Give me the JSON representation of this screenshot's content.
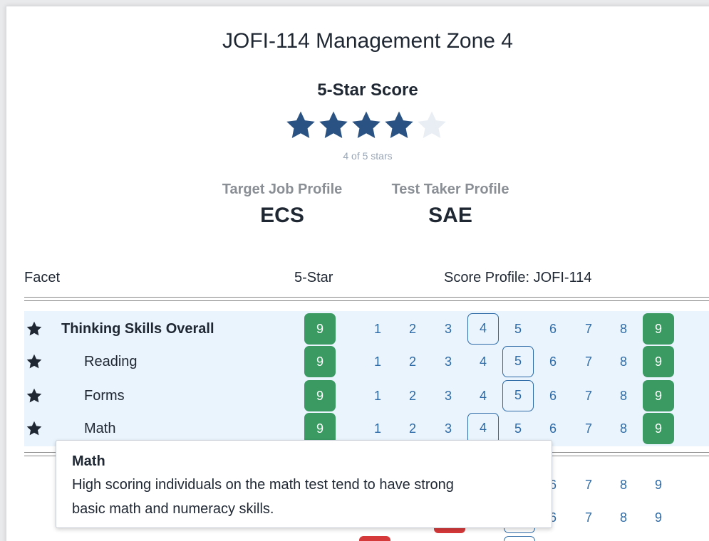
{
  "title": "JOFI-114 Management Zone 4",
  "score": {
    "heading": "5-Star Score",
    "stars_filled": 4,
    "stars_total": 5,
    "caption": "4 of 5 stars",
    "filled_color": "#2a5282",
    "empty_color": "#e9eef4"
  },
  "profiles": {
    "target": {
      "label": "Target Job Profile",
      "value": "ECS"
    },
    "taker": {
      "label": "Test Taker Profile",
      "value": "SAE"
    }
  },
  "table": {
    "headers": {
      "facet": "Facet",
      "five_star": "5-Star",
      "score_profile": "Score Profile: JOFI-114"
    },
    "scale": [
      "1",
      "2",
      "3",
      "4",
      "5",
      "6",
      "7",
      "8",
      "9"
    ],
    "rows": [
      {
        "name": "Thinking Skills Overall",
        "five_star": "9",
        "selected": "4",
        "icon": "star-icon"
      },
      {
        "name": "Reading",
        "five_star": "9",
        "selected": "5",
        "icon": "star-icon"
      },
      {
        "name": "Forms",
        "five_star": "9",
        "selected": "5",
        "icon": "star-icon"
      },
      {
        "name": "Math",
        "five_star": "9",
        "selected": "4",
        "icon": "star-icon"
      }
    ],
    "peek_rows": [
      {
        "values": [
          "6",
          "7",
          "8",
          "9"
        ]
      },
      {
        "values": [
          "6",
          "7",
          "8",
          "9"
        ]
      }
    ],
    "badge_color": "#3b9a62",
    "number_color": "#2d6aa6",
    "band_color": "#eaf4fd"
  },
  "tooltip": {
    "title": "Math",
    "body_line1": "High scoring individuals on the math test tend to have strong",
    "body_line2": "basic math and numeracy skills."
  }
}
